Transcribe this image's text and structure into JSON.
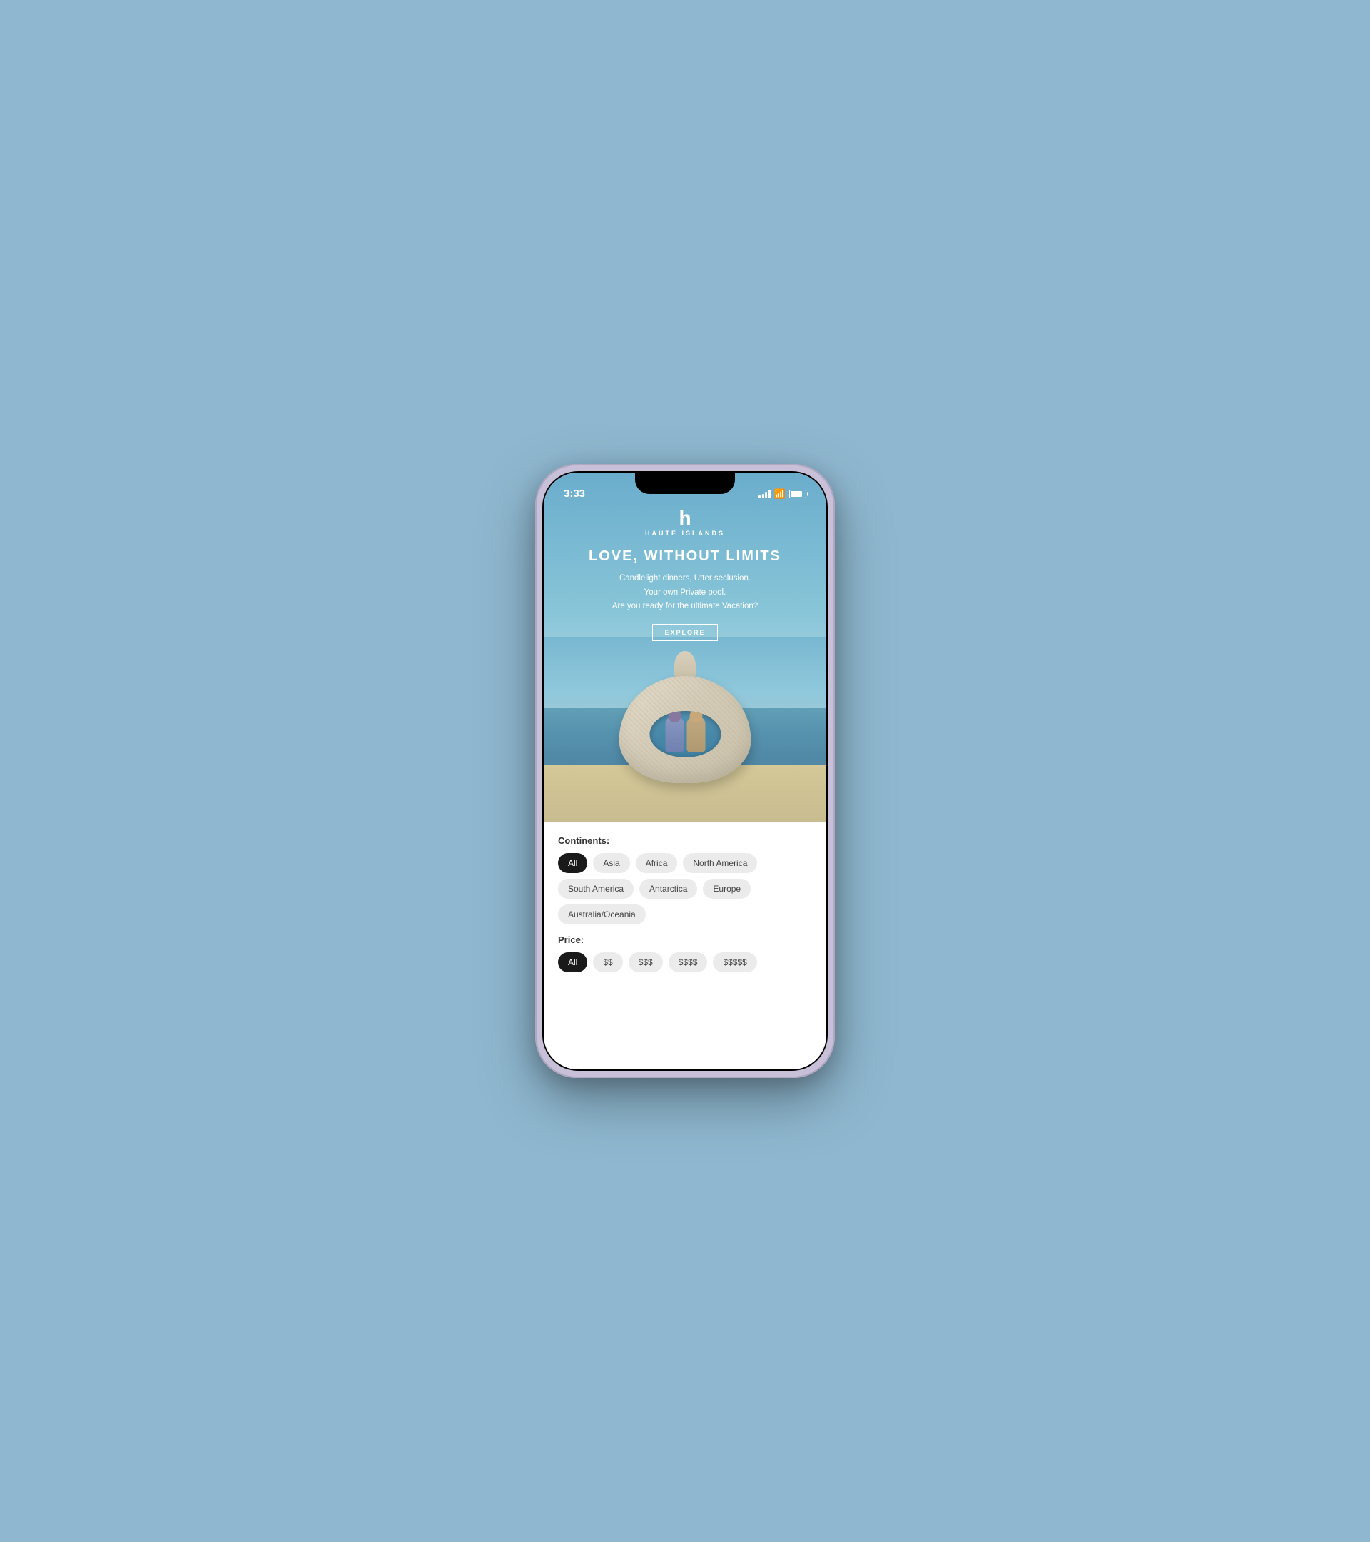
{
  "statusBar": {
    "time": "3:33"
  },
  "app": {
    "logoSymbol": "h",
    "logoName": "HAUTE ISLANDS",
    "heroTitle": "LOVE, WITHOUT LIMITS",
    "heroSubtitle1": "Candlelight dinners, Utter seclusion.",
    "heroSubtitle2": "Your own Private pool.",
    "heroSubtitle3": "Are you ready for the ultimate Vacation?",
    "exploreButton": "EXPLORE"
  },
  "continentsFilter": {
    "label": "Continents:",
    "tags": [
      {
        "id": "all-cont",
        "label": "All",
        "active": true
      },
      {
        "id": "asia",
        "label": "Asia",
        "active": false
      },
      {
        "id": "africa",
        "label": "Africa",
        "active": false
      },
      {
        "id": "north-america",
        "label": "North America",
        "active": false
      },
      {
        "id": "south-america",
        "label": "South America",
        "active": false
      },
      {
        "id": "antarctica",
        "label": "Antarctica",
        "active": false
      },
      {
        "id": "europe",
        "label": "Europe",
        "active": false
      },
      {
        "id": "australia",
        "label": "Australia/Oceania",
        "active": false
      }
    ]
  },
  "priceFilter": {
    "label": "Price:",
    "tags": [
      {
        "id": "all-price",
        "label": "All",
        "active": true
      },
      {
        "id": "two-dollar",
        "label": "$$",
        "active": false
      },
      {
        "id": "three-dollar",
        "label": "$$$",
        "active": false
      },
      {
        "id": "four-dollar",
        "label": "$$$$",
        "active": false
      },
      {
        "id": "five-dollar",
        "label": "$$$$$",
        "active": false
      }
    ]
  }
}
